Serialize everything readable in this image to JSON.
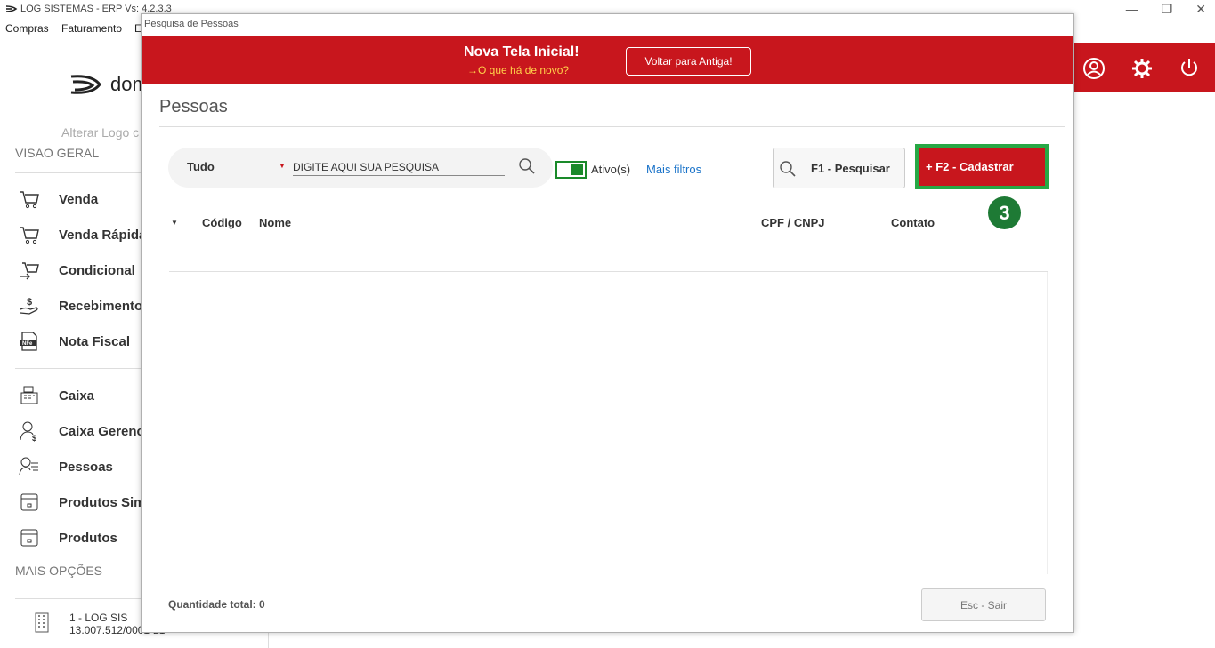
{
  "app": {
    "title": "LOG SISTEMAS - ERP Vs: 4.2.3.3",
    "menu": [
      "Compras",
      "Faturamento",
      "E"
    ]
  },
  "window_controls": [
    "—",
    "❐",
    "✕"
  ],
  "sidebar": {
    "logo_text": "dom",
    "alter_logo": "Alterar Logo c",
    "section_general": "VISAO GERAL",
    "items": [
      {
        "label": "Venda",
        "icon": "cart-icon"
      },
      {
        "label": "Venda Rápida",
        "icon": "cart-fast-icon"
      },
      {
        "label": "Condicional",
        "icon": "cart-swap-icon"
      },
      {
        "label": "Recebimento",
        "icon": "money-hand-icon"
      },
      {
        "label": "Nota Fiscal",
        "icon": "nfe-icon"
      },
      {
        "label": "Caixa",
        "icon": "cash-register-icon"
      },
      {
        "label": "Caixa Gerenc",
        "icon": "user-money-icon"
      },
      {
        "label": "Pessoas",
        "icon": "user-list-icon"
      },
      {
        "label": "Produtos Sim",
        "icon": "box-icon"
      },
      {
        "label": "Produtos",
        "icon": "box-icon"
      }
    ],
    "section_more": "MAIS OPÇÕES",
    "company_name": "1 - LOG SIS",
    "company_cnpj": "13.007.512/0001-21"
  },
  "dialog": {
    "title": "Pesquisa de Pessoas",
    "banner_title": "Nova Tela Inicial!",
    "banner_sub": "→O que há de novo?",
    "voltar_label": "Voltar para Antiga!",
    "page_title": "Pessoas",
    "filter_value": "Tudo",
    "search_placeholder": "DIGITE AQUI SUA PESQUISA",
    "toggle_label": "Ativo(s)",
    "toggle_on": true,
    "more_filters": "Mais filtros",
    "search_button": "F1 - Pesquisar",
    "add_button": "+ F2 - Cadastrar",
    "step_badge": "3",
    "columns": [
      "Código",
      "Nome",
      "CPF / CNPJ",
      "Contato"
    ],
    "rows": [],
    "total_label": "Quantidade total: 0",
    "exit_button": "Esc - Sair"
  },
  "colors": {
    "brand_red": "#c8161d",
    "highlight_green": "#27a845",
    "badge_green": "#1e7a35",
    "link_blue": "#1a73c9"
  }
}
